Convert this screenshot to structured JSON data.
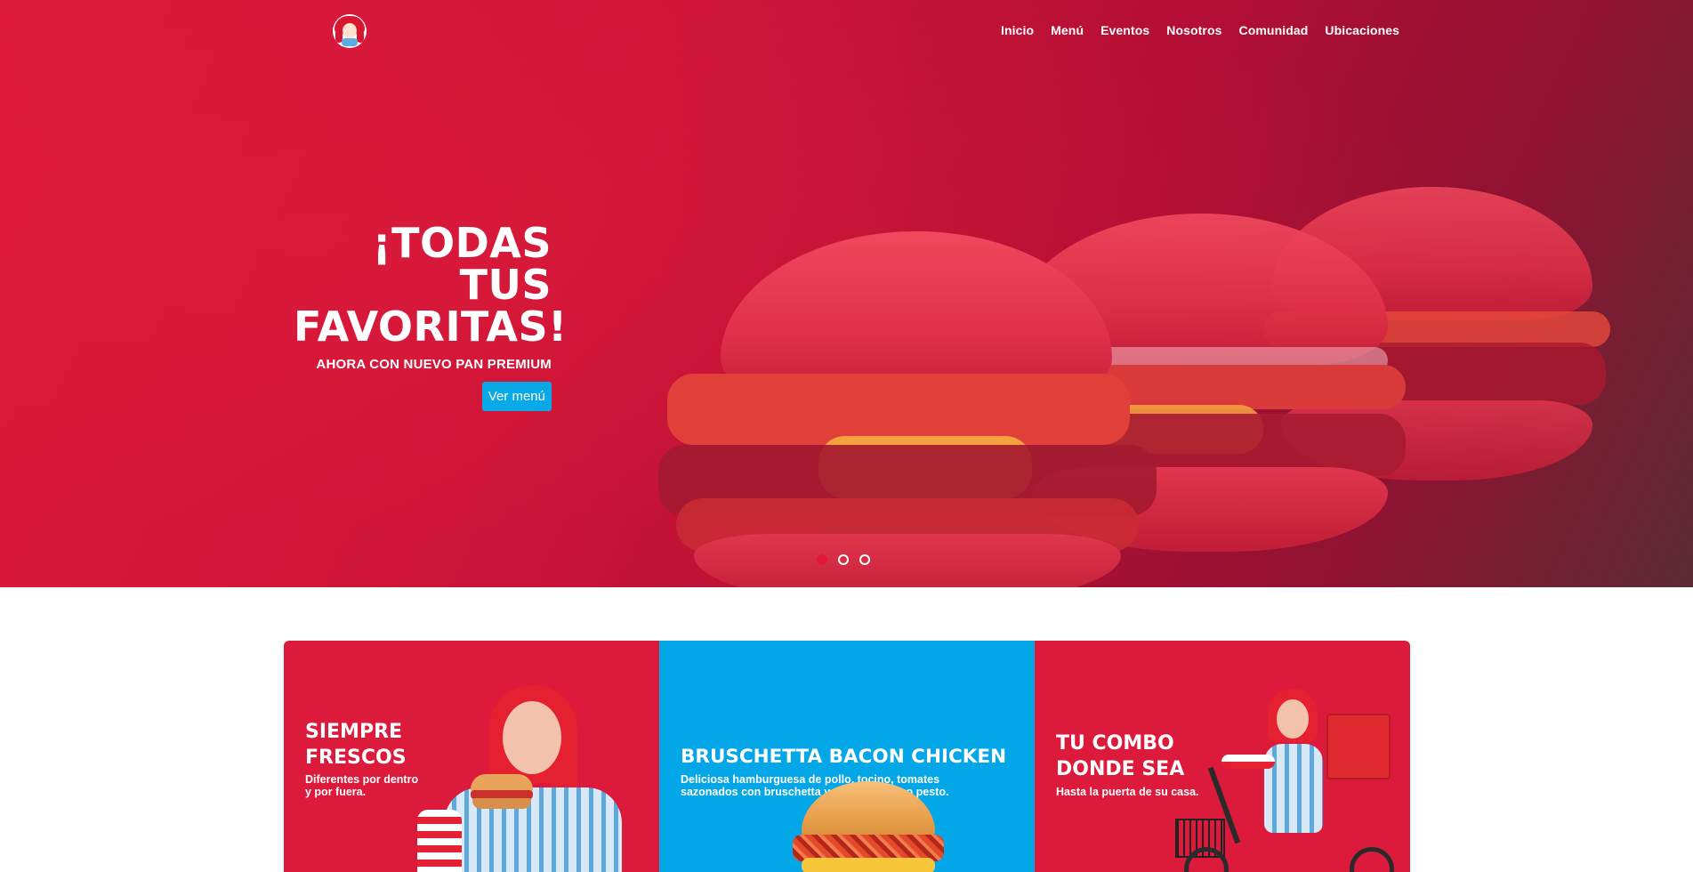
{
  "brand": {
    "logo": "wendys-logo-icon"
  },
  "nav": {
    "items": [
      "Inicio",
      "Menú",
      "Eventos",
      "Nosotros",
      "Comunidad",
      "Ubicaciones"
    ]
  },
  "hero": {
    "title_line1": "¡TODAS TUS",
    "title_line2": "FAVORITAS!",
    "subtitle": "AHORA CON NUEVO PAN PREMIUM",
    "button": "Ver menú",
    "slides_total": 3,
    "slide_active": 1,
    "background_color": "#dc1a3b"
  },
  "cards": [
    {
      "title_line1": "SIEMPRE",
      "title_line2": "FRESCOS",
      "desc_line1": "Diferentes por dentro",
      "desc_line2": "y por fuera.",
      "color": "#dc1a3b"
    },
    {
      "title_line1": "BRUSCHETTA BACON CHICKEN",
      "desc_line1": "Deliciosa hamburguesa de pollo, tocino, tomates",
      "desc_line2": "sazonados con bruschetta y salsa de queso pesto.",
      "color": "#03a6e6"
    },
    {
      "title_line1": "TU COMBO",
      "title_line2": "DONDE SEA",
      "desc_line1": "Hasta la puerta de su casa.",
      "color": "#dc1a3b"
    }
  ]
}
